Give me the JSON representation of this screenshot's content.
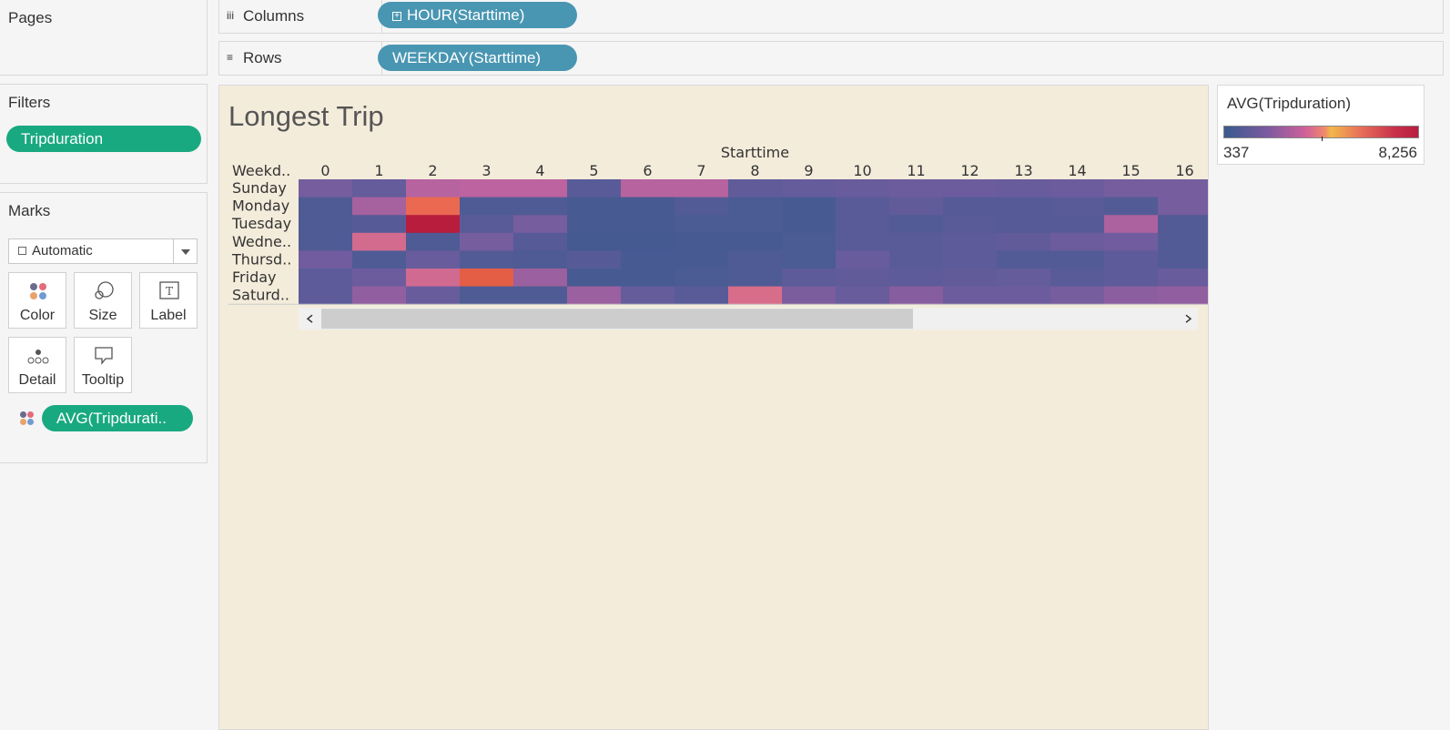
{
  "pages": {
    "title": "Pages"
  },
  "filters": {
    "title": "Filters",
    "pills": [
      "Tripduration"
    ]
  },
  "marks": {
    "title": "Marks",
    "mark_type": "Automatic",
    "buttons": {
      "color": "Color",
      "size": "Size",
      "label": "Label",
      "detail": "Detail",
      "tooltip": "Tooltip"
    },
    "color_pill": "AVG(Tripdurati.."
  },
  "shelves": {
    "columns": {
      "label": "Columns",
      "pill": "HOUR(Starttime)"
    },
    "rows": {
      "label": "Rows",
      "pill": "WEEKDAY(Starttime)"
    }
  },
  "viz": {
    "title": "Longest Trip"
  },
  "legend": {
    "title": "AVG(Tripduration)",
    "min": "337",
    "max": "8,256"
  },
  "chart_data": {
    "type": "heatmap",
    "title": "Longest Trip",
    "x_header": "Starttime",
    "y_header": "Weekd..",
    "x": [
      "0",
      "1",
      "2",
      "3",
      "4",
      "5",
      "6",
      "7",
      "8",
      "9",
      "10",
      "11",
      "12",
      "13",
      "14",
      "15",
      "16"
    ],
    "y": [
      "Sunday",
      "Monday",
      "Tuesday",
      "Wedne..",
      "Thursd..",
      "Friday",
      "Saturd.."
    ],
    "color_range": [
      337,
      8256
    ],
    "values": [
      [
        1900,
        1500,
        3100,
        3200,
        3200,
        1200,
        3100,
        3100,
        1400,
        1500,
        1600,
        1700,
        1700,
        1600,
        1700,
        1900,
        1900
      ],
      [
        900,
        2800,
        6300,
        900,
        900,
        700,
        700,
        1000,
        800,
        700,
        1200,
        1400,
        1100,
        1100,
        1200,
        1000,
        1900
      ],
      [
        900,
        1100,
        8256,
        1200,
        1900,
        700,
        700,
        800,
        800,
        700,
        1200,
        1000,
        1200,
        1100,
        1100,
        2900,
        1000
      ],
      [
        900,
        4000,
        900,
        1900,
        1100,
        600,
        600,
        700,
        700,
        800,
        1200,
        1200,
        1300,
        1400,
        1700,
        1800,
        1000
      ],
      [
        1800,
        900,
        1600,
        1000,
        900,
        1100,
        700,
        700,
        900,
        800,
        1600,
        1200,
        1300,
        1000,
        1000,
        1300,
        1000
      ],
      [
        1300,
        1700,
        3900,
        6800,
        2600,
        700,
        700,
        800,
        900,
        1300,
        1400,
        1300,
        1400,
        1500,
        1200,
        1300,
        1600
      ],
      [
        1300,
        2400,
        1600,
        900,
        900,
        2600,
        1500,
        1200,
        4200,
        2000,
        1600,
        2200,
        1700,
        1700,
        1900,
        2300,
        2400
      ]
    ]
  }
}
